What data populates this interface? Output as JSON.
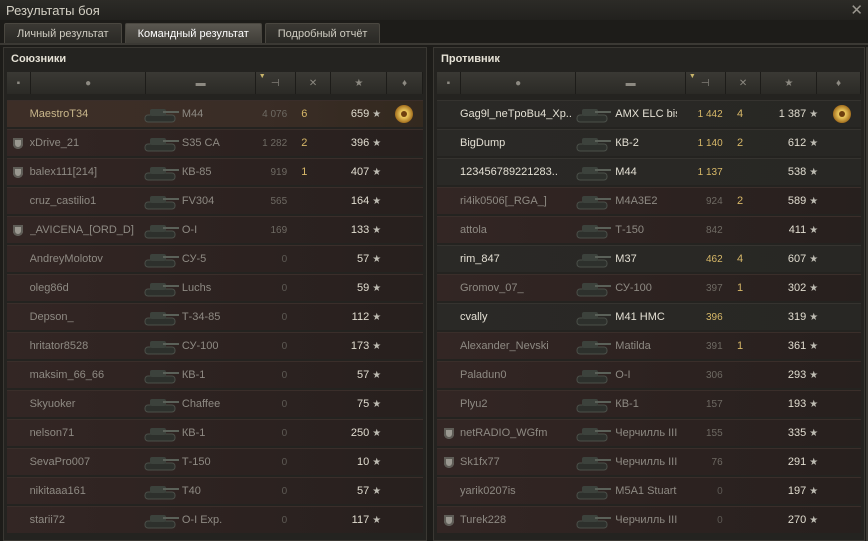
{
  "window": {
    "title": "Результаты боя",
    "close": "✕"
  },
  "tabs": [
    "Личный результат",
    "Командный результат",
    "Подробный отчёт"
  ],
  "allies": {
    "label": "Союзники",
    "rows": [
      {
        "clan": false,
        "name": "MaestroT34",
        "tank": "M44",
        "dmg": "4 076",
        "kills": "6",
        "xp": "659",
        "medal": true,
        "player": true
      },
      {
        "clan": true,
        "name": "xDrive_21",
        "tank": "S35 CA",
        "dmg": "1 282",
        "kills": "2",
        "xp": "396"
      },
      {
        "clan": true,
        "name": "balex111[214]",
        "tank": "КВ-85",
        "dmg": "919",
        "kills": "1",
        "xp": "407"
      },
      {
        "clan": false,
        "name": "cruz_castilio1",
        "tank": "FV304",
        "dmg": "565",
        "kills": "",
        "xp": "164"
      },
      {
        "clan": true,
        "name": "_AVICENA_[ORD_D]",
        "tank": "О-I",
        "dmg": "169",
        "kills": "",
        "xp": "133"
      },
      {
        "clan": false,
        "name": "AndreyMolotov",
        "tank": "СУ-5",
        "dmg": "0",
        "kills": "",
        "xp": "57"
      },
      {
        "clan": false,
        "name": "oleg86d",
        "tank": "Luchs",
        "dmg": "0",
        "kills": "",
        "xp": "59"
      },
      {
        "clan": false,
        "name": "Depson_",
        "tank": "Т-34-85",
        "dmg": "0",
        "kills": "",
        "xp": "112"
      },
      {
        "clan": false,
        "name": "hritator8528",
        "tank": "СУ-100",
        "dmg": "0",
        "kills": "",
        "xp": "173"
      },
      {
        "clan": false,
        "name": "maksim_66_66",
        "tank": "КВ-1",
        "dmg": "0",
        "kills": "",
        "xp": "57"
      },
      {
        "clan": false,
        "name": "Skyuoker",
        "tank": "Chaffee",
        "dmg": "0",
        "kills": "",
        "xp": "75"
      },
      {
        "clan": false,
        "name": "nelson71",
        "tank": "КВ-1",
        "dmg": "0",
        "kills": "",
        "xp": "250"
      },
      {
        "clan": false,
        "name": "SevaPro007",
        "tank": "Т-150",
        "dmg": "0",
        "kills": "",
        "xp": "10"
      },
      {
        "clan": false,
        "name": "nikitaaa161",
        "tank": "T40",
        "dmg": "0",
        "kills": "",
        "xp": "57"
      },
      {
        "clan": false,
        "name": "starii72",
        "tank": "О-I Exp.",
        "dmg": "0",
        "kills": "",
        "xp": "117"
      }
    ]
  },
  "enemies": {
    "label": "Противник",
    "rows": [
      {
        "clan": false,
        "name": "Gag9l_neTpoBu4_Xp..",
        "tank": "AMX ELC bis",
        "dmg": "1 442",
        "kills": "4",
        "xp": "1 387",
        "medal": true,
        "alive": true
      },
      {
        "clan": false,
        "name": "BigDump",
        "tank": "КВ-2",
        "dmg": "1 140",
        "kills": "2",
        "xp": "612",
        "alive": true
      },
      {
        "clan": false,
        "name": "123456789221283..",
        "tank": "M44",
        "dmg": "1 137",
        "kills": "",
        "xp": "538",
        "alive": true
      },
      {
        "clan": false,
        "name": "ri4ik0506[_RGA_]",
        "tank": "M4A3E2",
        "dmg": "924",
        "kills": "2",
        "xp": "589"
      },
      {
        "clan": false,
        "name": "attola",
        "tank": "Т-150",
        "dmg": "842",
        "kills": "",
        "xp": "411"
      },
      {
        "clan": false,
        "name": "rim_847",
        "tank": "M37",
        "dmg": "462",
        "kills": "4",
        "xp": "607",
        "alive": true
      },
      {
        "clan": false,
        "name": "Gromov_07_",
        "tank": "СУ-100",
        "dmg": "397",
        "kills": "1",
        "xp": "302"
      },
      {
        "clan": false,
        "name": "cvally",
        "tank": "M41 HMC",
        "dmg": "396",
        "kills": "",
        "xp": "319",
        "alive": true
      },
      {
        "clan": false,
        "name": "Alexander_Nevski",
        "tank": "Matilda",
        "dmg": "391",
        "kills": "1",
        "xp": "361"
      },
      {
        "clan": false,
        "name": "Paladun0",
        "tank": "О-I",
        "dmg": "306",
        "kills": "",
        "xp": "293"
      },
      {
        "clan": false,
        "name": "Plyu2",
        "tank": "КВ-1",
        "dmg": "157",
        "kills": "",
        "xp": "193"
      },
      {
        "clan": true,
        "name": "netRADIO_WGfm",
        "tank": "Черчилль III",
        "dmg": "155",
        "kills": "",
        "xp": "335"
      },
      {
        "clan": true,
        "name": "Sk1fx77",
        "tank": "Черчилль III",
        "dmg": "76",
        "kills": "",
        "xp": "291"
      },
      {
        "clan": false,
        "name": "yarik0207is",
        "tank": "M5A1 Stuart",
        "dmg": "0",
        "kills": "",
        "xp": "197"
      },
      {
        "clan": true,
        "name": "Turek228",
        "tank": "Черчилль III",
        "dmg": "0",
        "kills": "",
        "xp": "270"
      }
    ]
  },
  "headers": {
    "sort_mark": "▼",
    "xp_icon": "★"
  },
  "icons": {
    "clan": "clan-emblem-icon",
    "tank": "tank-icon",
    "medal": "medal-icon"
  }
}
